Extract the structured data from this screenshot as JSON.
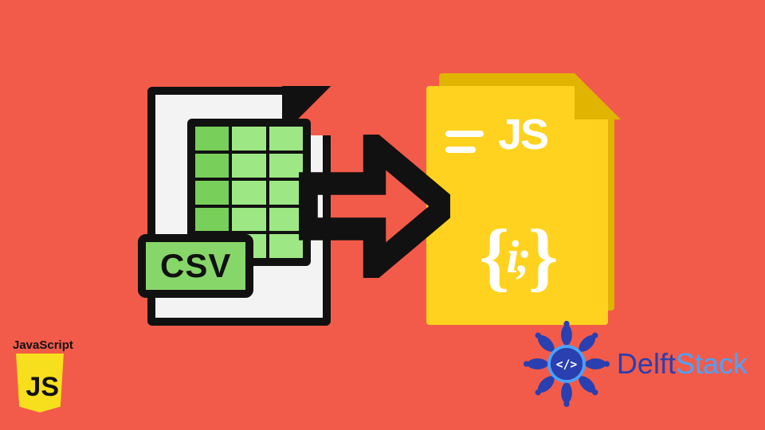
{
  "colors": {
    "background": "#f25b49",
    "csv_green": "#86d66a",
    "js_yellow": "#ffd21f",
    "arrow_black": "#111111",
    "brand_blue_dark": "#2a3fb0",
    "brand_blue_light": "#4aa3ff",
    "js_shield_yellow": "#f7df1e"
  },
  "csv_file": {
    "badge_text": "CSV"
  },
  "arrow": {
    "name": "right-arrow"
  },
  "js_file": {
    "label": "JS",
    "braces": "{",
    "braces_mid": "i",
    "braces_mid_after": ";",
    "braces_close": "}"
  },
  "js_badge": {
    "title": "JavaScript",
    "shield_text": "JS"
  },
  "brand": {
    "name_part1": "Delft",
    "name_part2": "Stack",
    "tag_symbol": "</>"
  }
}
